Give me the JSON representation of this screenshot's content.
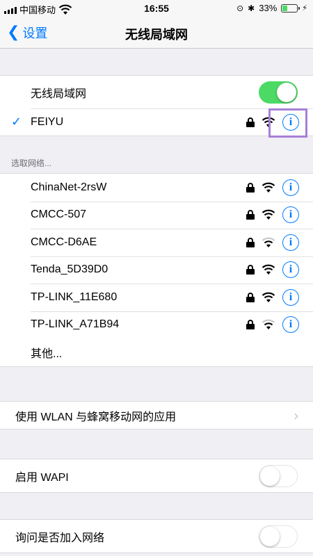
{
  "status_bar": {
    "carrier": "中国移动",
    "time": "16:55",
    "battery_text": "33%",
    "battery_level": 0.33
  },
  "nav": {
    "back_label": "设置",
    "title": "无线局域网"
  },
  "wifi_toggle": {
    "label": "无线局域网",
    "on": true
  },
  "connected_network": {
    "name": "FEIYU",
    "locked": true,
    "signal": "full"
  },
  "choose_header": "选取网络...",
  "networks": [
    {
      "name": "ChinaNet-2rsW",
      "locked": true,
      "signal": "full"
    },
    {
      "name": "CMCC-507",
      "locked": true,
      "signal": "full"
    },
    {
      "name": "CMCC-D6AE",
      "locked": true,
      "signal": "weak"
    },
    {
      "name": "Tenda_5D39D0",
      "locked": true,
      "signal": "full"
    },
    {
      "name": "TP-LINK_11E680",
      "locked": true,
      "signal": "full"
    },
    {
      "name": "TP-LINK_A71B94",
      "locked": true,
      "signal": "weak"
    }
  ],
  "other_label": "其他...",
  "wlan_apps_label": "使用 WLAN 与蜂窝移动网的应用",
  "wapi": {
    "label": "启用 WAPI",
    "on": false
  },
  "ask_join": {
    "label": "询问是否加入网络",
    "on": false
  },
  "colors": {
    "accent": "#007aff",
    "toggle_on": "#4cd964",
    "highlight": "#a77fd6"
  },
  "icons": {
    "back": "chevron-left-icon",
    "check": "checkmark-icon",
    "lock": "lock-icon",
    "wifi": "wifi-icon",
    "info": "info-icon",
    "disclosure": "chevron-right-icon"
  }
}
